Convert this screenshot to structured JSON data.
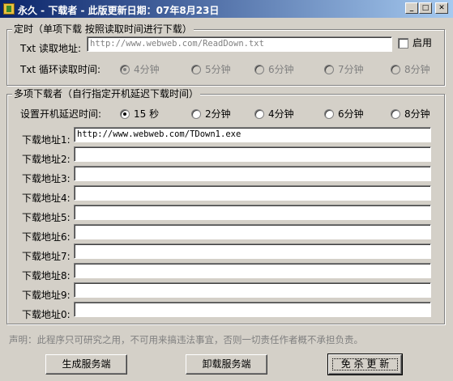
{
  "window": {
    "title": "永久 - 下载者 - 此版更新日期：07年8月23日"
  },
  "single": {
    "group_title": "定时（单项下载  按照读取时间进行下载）",
    "read_label": "Txt 读取地址:",
    "read_value": "http://www.webweb.com/ReadDown.txt",
    "enable_label": "启用",
    "loop_label": "Txt 循环读取时间:",
    "intervals": [
      "4分钟",
      "5分钟",
      "6分钟",
      "7分钟",
      "8分钟"
    ],
    "selected_interval": "4分钟"
  },
  "multi": {
    "group_title": "多项下载者（自行指定开机延迟下载时间）",
    "delay_label": "设置开机延迟时间:",
    "delays": [
      "15 秒",
      "2分钟",
      "4分钟",
      "6分钟",
      "8分钟"
    ],
    "selected_delay": "15 秒",
    "urls": [
      {
        "label": "下载地址1:",
        "value": "http://www.webweb.com/TDown1.exe"
      },
      {
        "label": "下载地址2:",
        "value": ""
      },
      {
        "label": "下载地址3:",
        "value": ""
      },
      {
        "label": "下载地址4:",
        "value": ""
      },
      {
        "label": "下载地址5:",
        "value": ""
      },
      {
        "label": "下载地址6:",
        "value": ""
      },
      {
        "label": "下载地址7:",
        "value": ""
      },
      {
        "label": "下载地址8:",
        "value": ""
      },
      {
        "label": "下载地址9:",
        "value": ""
      },
      {
        "label": "下载地址0:",
        "value": ""
      }
    ]
  },
  "notice": "声明：此程序只可研究之用，不可用来搞违法事宜，否则一切责任作者概不承担负责。",
  "buttons": {
    "generate": "生成服务端",
    "uninstall": "卸载服务端",
    "update": "免 杀 更 新"
  },
  "colors": {
    "title_start": "#0a246a",
    "title_end": "#a6caf0",
    "face": "#d4d0c8"
  }
}
